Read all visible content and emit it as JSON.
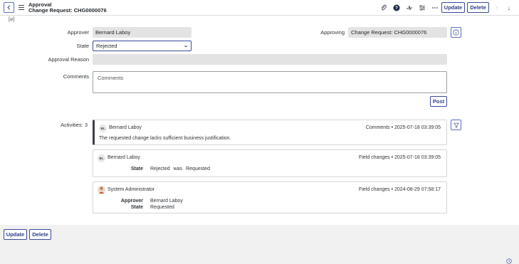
{
  "header": {
    "title": "Approval",
    "subtitle": "Change Request: CHG0000076",
    "update_label": "Update",
    "delete_label": "Delete"
  },
  "attachments_marker": "[⌀]",
  "form": {
    "approver_label": "Approver",
    "approver_value": "Bernard Laboy",
    "approving_label": "Approving",
    "approving_value": "Change Request: CHG0000076",
    "state_label": "State",
    "state_value": "Rejected",
    "approval_reason_label": "Approval Reason",
    "approval_reason_value": "",
    "comments_label": "Comments",
    "comments_placeholder": "Comments",
    "post_label": "Post"
  },
  "activities": {
    "label": "Activities: 3",
    "items": [
      {
        "initials": "BL",
        "author": "Bernard Laboy",
        "type": "Comments",
        "timestamp": "2025-07-18 03:39:05",
        "text": "The requested change lacks sufficient business justification."
      },
      {
        "initials": "BL",
        "author": "Bernard Laboy",
        "type": "Field changes",
        "timestamp": "2025-07-18 03:39:05",
        "changes": [
          {
            "field": "State",
            "new": "Rejected",
            "was": "was",
            "old": "Requested"
          }
        ]
      },
      {
        "initials": "",
        "author": "System Administrator",
        "type": "Field changes",
        "timestamp": "2024-08-29 07:58:17",
        "changes": [
          {
            "field": "Approver",
            "new": "Bernard Laboy"
          },
          {
            "field": "State",
            "new": "Requested"
          }
        ]
      }
    ]
  },
  "footer": {
    "update_label": "Update",
    "delete_label": "Delete"
  },
  "colors": {
    "accent": "#3a4a9c",
    "header_bg": "#ffffff",
    "field_bg": "#e3e3e3"
  }
}
